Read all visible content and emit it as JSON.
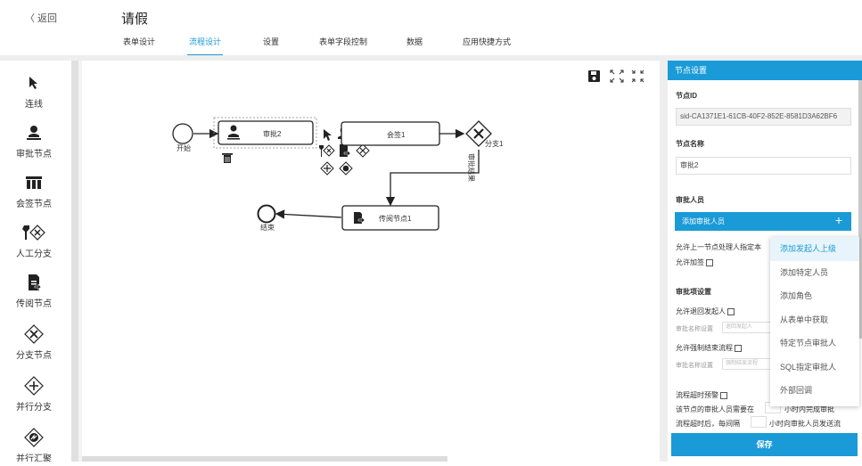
{
  "header": {
    "back_label": "〈 返回",
    "title": "请假",
    "tabs": [
      {
        "label": "表单设计",
        "active": false
      },
      {
        "label": "流程设计",
        "active": true
      },
      {
        "label": "设置",
        "active": false
      },
      {
        "label": "表单字段控制",
        "active": false
      },
      {
        "label": "数据",
        "active": false
      },
      {
        "label": "应用快捷方式",
        "active": false
      }
    ]
  },
  "toolbar": {
    "items": [
      {
        "label": "连线",
        "icon": "pointer-icon"
      },
      {
        "label": "审批节点",
        "icon": "user-icon"
      },
      {
        "label": "会签节点",
        "icon": "group-icon"
      },
      {
        "label": "人工分支",
        "icon": "manual-branch-icon"
      },
      {
        "label": "传阅节点",
        "icon": "document-icon"
      },
      {
        "label": "分支节点",
        "icon": "exclusive-gateway-icon"
      },
      {
        "label": "并行分支",
        "icon": "parallel-gateway-icon"
      },
      {
        "label": "并行汇聚",
        "icon": "converge-gateway-icon"
      }
    ]
  },
  "canvas": {
    "nodes": {
      "start": "开始",
      "approve2": "审批2",
      "countersign1": "会签1",
      "branch1": "分支1",
      "circulate1": "传阅节点1",
      "end": "结束"
    },
    "flow_label": "审批结果"
  },
  "panel": {
    "header": "节点设置",
    "node_id_label": "节点ID",
    "node_id_value": "sid-CA1371E1-61CB-40F2-852E-8581D3A62BF6",
    "node_name_label": "节点名称",
    "node_name_value": "审批2",
    "approver_label": "审批人员",
    "add_approver_label": "添加审批人员",
    "add_icon": "+",
    "allow_prev_label": "允许上一节点处理人指定本",
    "allow_sign_label": "允许加签",
    "approval_settings_label": "审批项设置",
    "allow_return_label": "允许退回发起人",
    "return_name_label": "审批名称设置",
    "return_name_placeholder": "退回发起人",
    "allow_force_end_label": "允许强制结束流程",
    "force_name_label": "审批名称设置",
    "force_name_placeholder": "强制结束流程",
    "timeout_label": "流程超时预警",
    "timeout_line1_a": "该节点的审批人员需要在",
    "timeout_line1_b": "小时内完成审批",
    "timeout_line2_a": "流程超时后，每间隔",
    "timeout_line2_b": "小时向审批人员发送流",
    "save_label": "保存"
  },
  "dropdown": {
    "items": [
      {
        "label": "添加发起人上级",
        "highlight": true
      },
      {
        "label": "添加特定人员",
        "highlight": false
      },
      {
        "label": "添加角色",
        "highlight": false
      },
      {
        "label": "从表单中获取",
        "highlight": false
      },
      {
        "label": "特定节点审批人",
        "highlight": false
      },
      {
        "label": "SQL指定审批人",
        "highlight": false
      },
      {
        "label": "外部回调",
        "highlight": false
      }
    ]
  },
  "colors": {
    "accent": "#1a9bd7"
  }
}
